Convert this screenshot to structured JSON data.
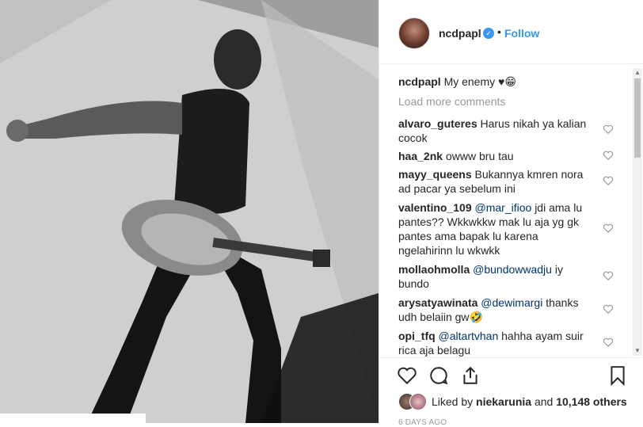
{
  "post": {
    "username": "ncdpapl",
    "follow_label": "Follow",
    "dot": "•",
    "caption": {
      "user": "ncdpapl",
      "text": "My enemy ♥😁"
    },
    "load_more": "Load more comments",
    "comments": [
      {
        "user": "alvaro_guteres",
        "text": "Harus nikah ya kalian",
        "text2": "cocok"
      },
      {
        "user": "haa_2nk",
        "text": "owww bru tau"
      },
      {
        "user": "mayy_queens",
        "text": "Bukannya kmren nora",
        "text2": "ad pacar ya sebelum ini"
      },
      {
        "user": "valentino_109",
        "mention": "@mar_ifioo",
        "text": "jdi ama lu",
        "text2": "pantes?? Wkkwkkw mak lu aja yg gk",
        "text3": "pantes ama bapak lu karena",
        "text4": "ngelahirinn lu wkwkk"
      },
      {
        "user": "mollaohmolla",
        "mention": "@bundowwadju",
        "text": "iy",
        "text2": "bundo"
      },
      {
        "user": "arysatyawinata",
        "mention": "@dewimargi",
        "text": "thanks",
        "text2": "udh belaiin gw🤣"
      },
      {
        "user": "opi_tfq",
        "mention": "@altartvhan",
        "text": "hahha ayam suir",
        "text2": "rica aja belagu"
      }
    ],
    "likes": {
      "prefix": "Liked by",
      "user": "niekarunia",
      "connector": "and",
      "count": "10,148 others"
    },
    "time": "6 DAYS AGO"
  },
  "icons": {
    "verified": "verified-badge-icon",
    "like": "heart-icon",
    "comment": "comment-bubble-icon",
    "share": "share-icon",
    "save": "bookmark-icon"
  },
  "colors": {
    "accent": "#3897f0",
    "text": "#262626",
    "muted": "#999999"
  }
}
